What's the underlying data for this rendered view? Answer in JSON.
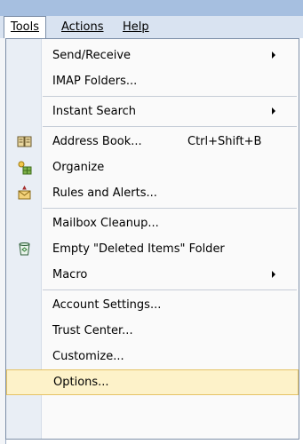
{
  "menubar": {
    "items": [
      {
        "label": "Tools",
        "active": true
      },
      {
        "label": "Actions",
        "active": false
      },
      {
        "label": "Help",
        "active": false
      }
    ]
  },
  "menu": {
    "items": [
      {
        "label": "Send/Receive",
        "submenu": true
      },
      {
        "label": "IMAP Folders..."
      },
      {
        "label": "Instant Search",
        "submenu": true
      },
      {
        "label": "Address Book...",
        "shortcut": "Ctrl+Shift+B",
        "icon": "address-book-icon"
      },
      {
        "label": "Organize",
        "icon": "organize-icon"
      },
      {
        "label": "Rules and Alerts...",
        "icon": "rules-alerts-icon"
      },
      {
        "label": "Mailbox Cleanup..."
      },
      {
        "label": "Empty \"Deleted Items\" Folder",
        "icon": "recycle-bin-icon"
      },
      {
        "label": "Macro",
        "submenu": true
      },
      {
        "label": "Account Settings..."
      },
      {
        "label": "Trust Center..."
      },
      {
        "label": "Customize..."
      },
      {
        "label": "Options...",
        "highlighted": true
      }
    ]
  },
  "colors": {
    "menubar_bg": "#d9e3f1",
    "gutter_bg": "#e9eef5",
    "highlight_bg": "#fdf2c9",
    "highlight_border": "#e5c365"
  }
}
